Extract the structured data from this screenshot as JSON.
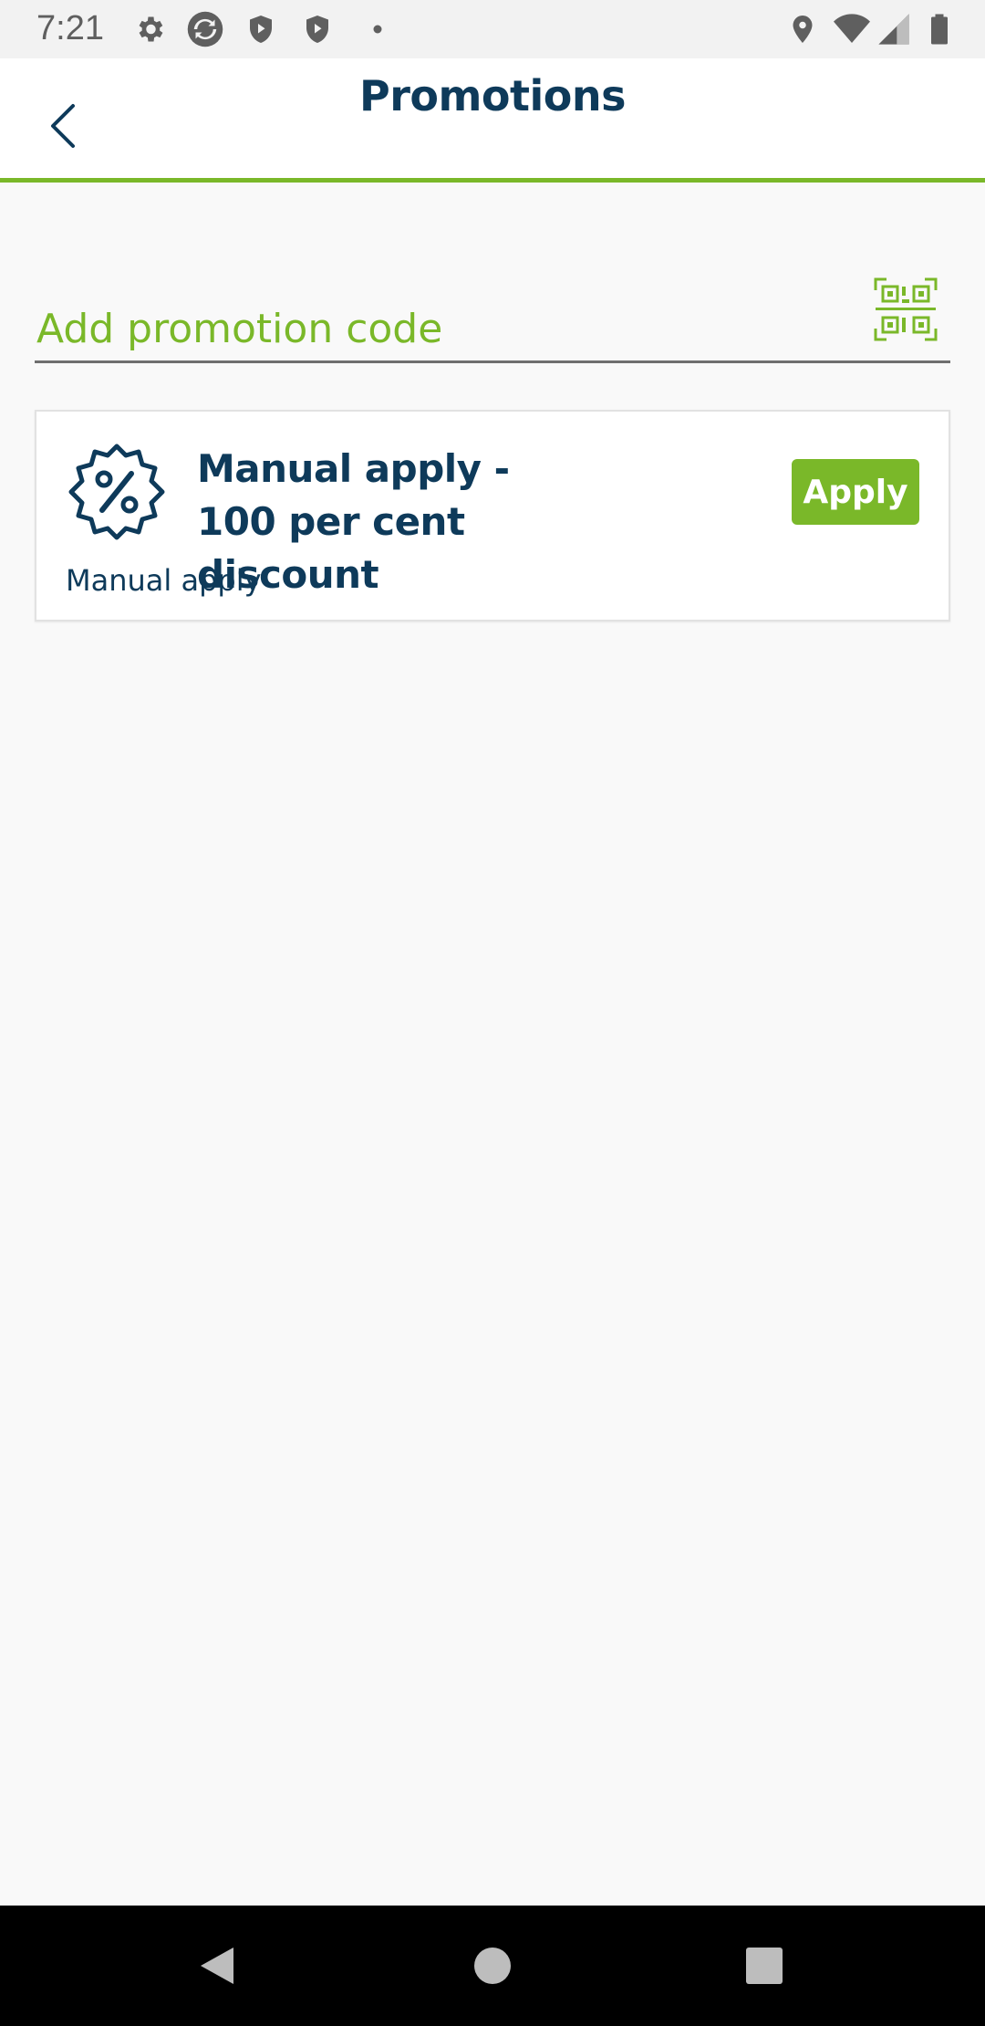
{
  "status_bar": {
    "time": "7:21"
  },
  "header": {
    "title": "Promotions"
  },
  "promo_code": {
    "placeholder": "Add promotion code",
    "value": ""
  },
  "promotions": [
    {
      "title": "Manual apply - 100 per cent discount",
      "subtitle": "Manual apply",
      "button_label": "Apply"
    }
  ],
  "colors": {
    "accent": "#7ab829",
    "primary_text": "#0e3a5a",
    "background": "#f9f9f9"
  },
  "icons": {
    "back": "chevron-left-icon",
    "qr": "qr-code-scan-icon",
    "discount": "percent-badge-icon"
  }
}
